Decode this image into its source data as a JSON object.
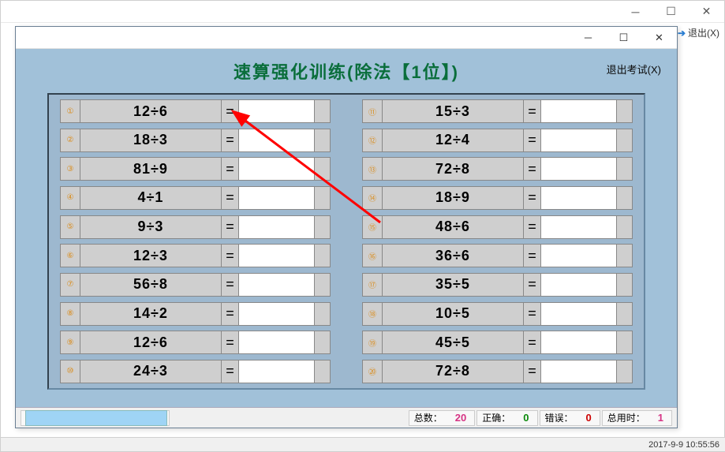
{
  "outer": {
    "exit_label": "退出(X)",
    "timestamp": "2017-9-9 10:55:56"
  },
  "quiz": {
    "title": "速算强化训练(除法【1位】)",
    "exit_exam_label": "退出考试(X)",
    "left": [
      {
        "n": "①",
        "expr": "12÷6"
      },
      {
        "n": "②",
        "expr": "18÷3"
      },
      {
        "n": "③",
        "expr": "81÷9"
      },
      {
        "n": "④",
        "expr": "4÷1"
      },
      {
        "n": "⑤",
        "expr": "9÷3"
      },
      {
        "n": "⑥",
        "expr": "12÷3"
      },
      {
        "n": "⑦",
        "expr": "56÷8"
      },
      {
        "n": "⑧",
        "expr": "14÷2"
      },
      {
        "n": "⑨",
        "expr": "12÷6"
      },
      {
        "n": "⑩",
        "expr": "24÷3"
      }
    ],
    "right": [
      {
        "n": "⑪",
        "expr": "15÷3"
      },
      {
        "n": "⑫",
        "expr": "12÷4"
      },
      {
        "n": "⑬",
        "expr": "72÷8"
      },
      {
        "n": "⑭",
        "expr": "18÷9"
      },
      {
        "n": "⑮",
        "expr": "48÷6"
      },
      {
        "n": "⑯",
        "expr": "36÷6"
      },
      {
        "n": "⑰",
        "expr": "35÷5"
      },
      {
        "n": "⑱",
        "expr": "10÷5"
      },
      {
        "n": "⑲",
        "expr": "45÷5"
      },
      {
        "n": "⑳",
        "expr": "72÷8"
      }
    ]
  },
  "status": {
    "total_label": "总数：",
    "total_value": "20",
    "correct_label": "正确：",
    "correct_value": "0",
    "wrong_label": "错误：",
    "wrong_value": "0",
    "time_label": "总用时：",
    "time_value": "1"
  },
  "eq_sign": "="
}
